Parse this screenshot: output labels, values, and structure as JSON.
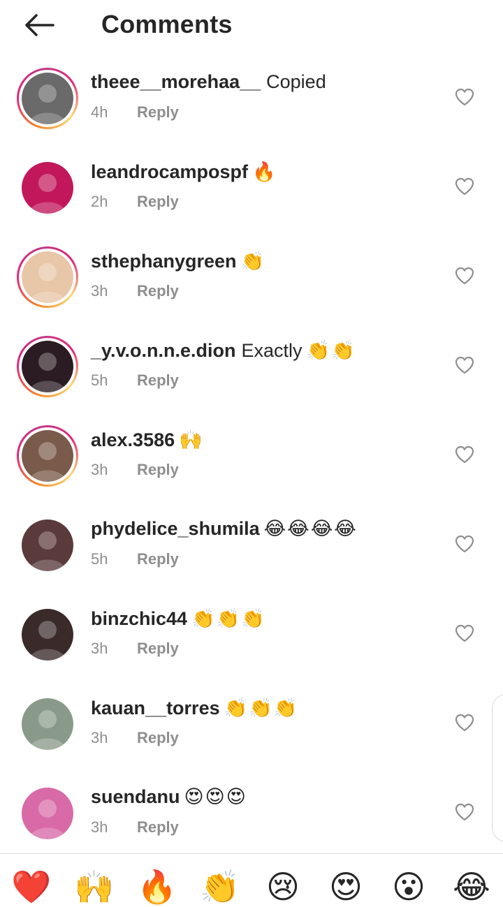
{
  "header": {
    "title": "Comments"
  },
  "comments": [
    {
      "username": "theee__morehaa__",
      "text": "Copied",
      "emoji": "",
      "time": "4h",
      "reply_label": "Reply",
      "avatar_color": "#6a6a6a",
      "story_ring": true
    },
    {
      "username": "leandrocampospf",
      "text": "",
      "emoji": "🔥",
      "time": "2h",
      "reply_label": "Reply",
      "avatar_color": "#c2185b",
      "story_ring": false
    },
    {
      "username": "sthephanygreen",
      "text": "",
      "emoji": "👏",
      "time": "3h",
      "reply_label": "Reply",
      "avatar_color": "#e8c6a8",
      "story_ring": true
    },
    {
      "username": "_y.v.o.n.n.e.dion",
      "text": "Exactly",
      "emoji": "👏👏",
      "time": "5h",
      "reply_label": "Reply",
      "avatar_color": "#2a1c22",
      "story_ring": true
    },
    {
      "username": "alex.3586",
      "text": "",
      "emoji": "🙌",
      "time": "3h",
      "reply_label": "Reply",
      "avatar_color": "#7a5a4a",
      "story_ring": true
    },
    {
      "username": "phydelice_shumila",
      "text": "",
      "emoji": "😂😂😂😂",
      "time": "5h",
      "reply_label": "Reply",
      "avatar_color": "#5a3a3a",
      "story_ring": false
    },
    {
      "username": "binzchic44",
      "text": "",
      "emoji": "👏👏👏",
      "time": "3h",
      "reply_label": "Reply",
      "avatar_color": "#3a2a2a",
      "story_ring": false
    },
    {
      "username": "kauan__torres",
      "text": "",
      "emoji": "👏👏👏",
      "time": "3h",
      "reply_label": "Reply",
      "avatar_color": "#8a9a8a",
      "story_ring": false
    },
    {
      "username": "suendanu",
      "text": "",
      "emoji": "😍😍😍",
      "time": "3h",
      "reply_label": "Reply",
      "avatar_color": "#d86aa8",
      "story_ring": false
    }
  ],
  "emoji_bar": [
    "❤️",
    "🙌",
    "🔥",
    "👏",
    "😢",
    "😍",
    "😮",
    "😂"
  ],
  "colors": {
    "text": "#262626",
    "secondary": "#8e8e8e",
    "divider": "#dbdbdb",
    "heart": "#8e8e8e"
  }
}
